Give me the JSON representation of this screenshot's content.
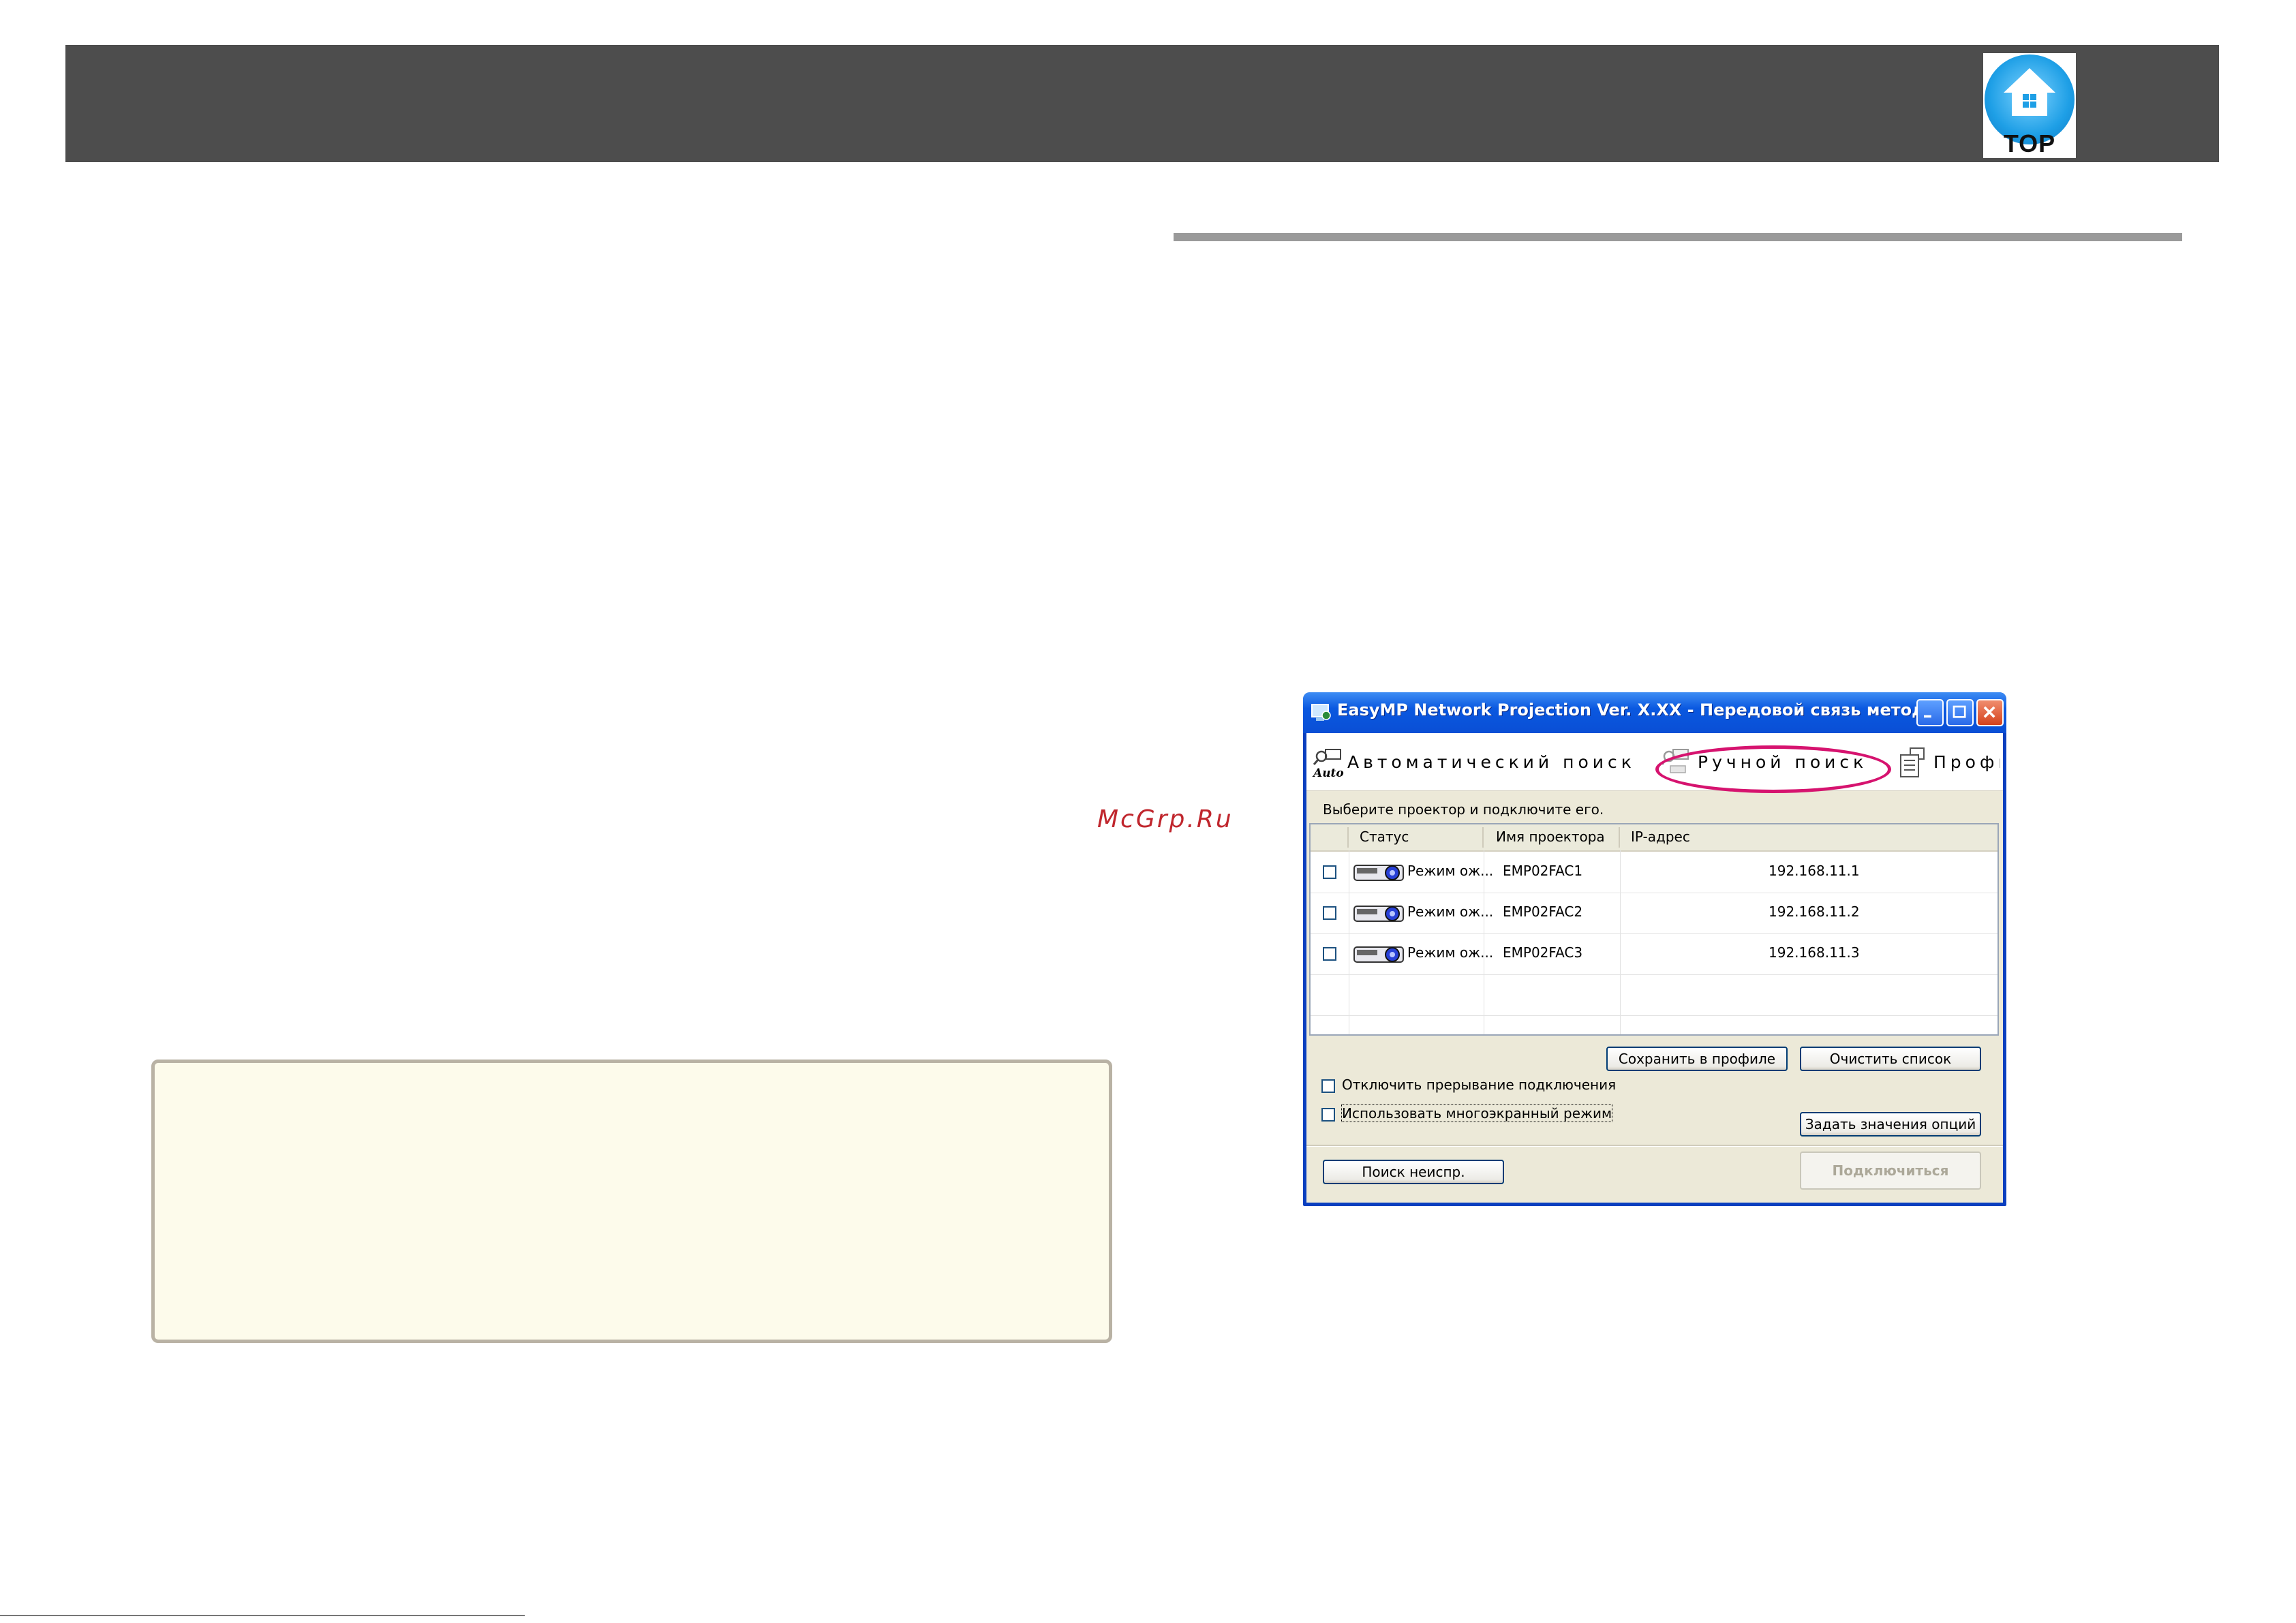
{
  "header": {
    "top_logo_text": "TOP",
    "bar_color": "#4d4d4d"
  },
  "watermark": "McGrp.Ru",
  "dialog": {
    "title": "EasyMP Network Projection Ver. X.XX - Передовой связь метод -",
    "toolbar": {
      "auto_search": "Автоматический поиск",
      "auto_icon_text": "Auto",
      "manual_search": "Ручной поиск",
      "profile": "Профи"
    },
    "instruction": "Выберите проектор и подключите его.",
    "columns": [
      "Статус",
      "Имя проектора",
      "IP-адрес"
    ],
    "rows": [
      {
        "status": "Режим ож...",
        "name": "EMP02FAC1",
        "ip": "192.168.11.1"
      },
      {
        "status": "Режим ож...",
        "name": "EMP02FAC2",
        "ip": "192.168.11.2"
      },
      {
        "status": "Режим ож...",
        "name": "EMP02FAC3",
        "ip": "192.168.11.3"
      }
    ],
    "buttons": {
      "save_profile": "Сохранить в профиле",
      "clear_list": "Очистить список",
      "set_options": "Задать значения опций",
      "search_unspecified": "Поиск неиспр.",
      "connect": "Подключиться"
    },
    "options": {
      "disable_interrupt": "Отключить прерывание подключения",
      "multiscreen": "Использовать многоэкранный режим"
    }
  },
  "colors": {
    "highlight": "#d6136f",
    "note_bg": "#fdfbeb",
    "titlebar": "#0a58e0"
  }
}
